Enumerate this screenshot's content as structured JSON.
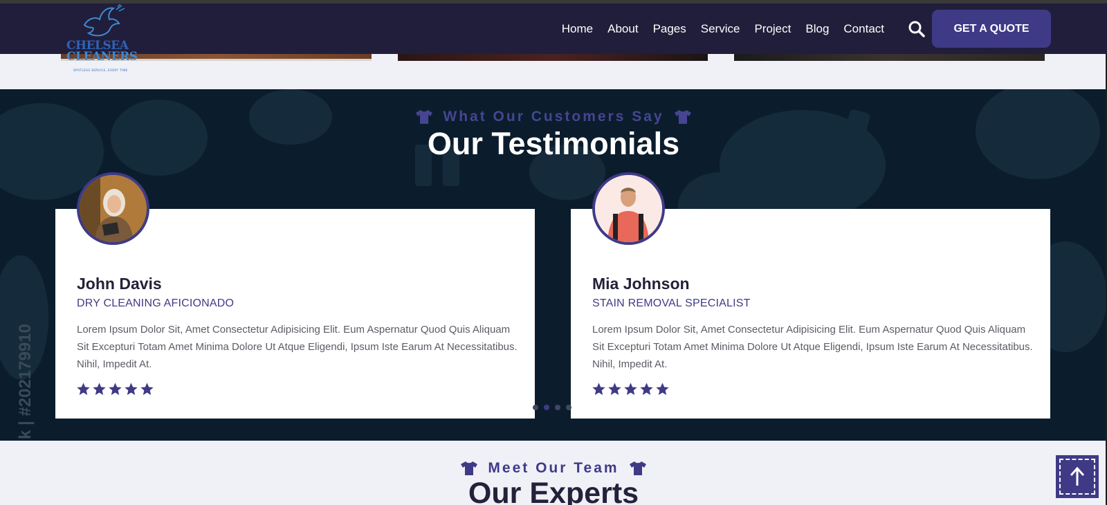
{
  "brand": {
    "name_line1": "CHELSEA",
    "name_line2": "CLEANERS",
    "tagline": "SPOTLESS SERVICE, EVERY TIME"
  },
  "nav": {
    "items": [
      "Home",
      "About",
      "Pages",
      "Service",
      "Project",
      "Blog",
      "Contact"
    ],
    "quote_label": "GET A QUOTE",
    "icons": {
      "search": "search-icon"
    }
  },
  "testimonials": {
    "subtitle": "What Our Customers Say",
    "title": "Our Testimonials",
    "items": [
      {
        "name": "John Davis",
        "role": "DRY CLEANING AFICIONADO",
        "text": "Lorem Ipsum Dolor Sit, Amet Consectetur Adipisicing Elit. Eum Aspernatur Quod Quis Aliquam Sit Excepturi Totam Amet Minima Dolore Ut Atque Eligendi, Ipsum Iste Earum At Necessitatibus. Nihil, Impedit At.",
        "rating": 5
      },
      {
        "name": "Mia Johnson",
        "role": "STAIN REMOVAL SPECIALIST",
        "text": "Lorem Ipsum Dolor Sit, Amet Consectetur Adipisicing Elit. Eum Aspernatur Quod Quis Aliquam Sit Excepturi Totam Amet Minima Dolore Ut Atque Eligendi, Ipsum Iste Earum At Necessitatibus. Nihil, Impedit At.",
        "rating": 5
      }
    ],
    "carousel_active_index": 1,
    "carousel_count": 4
  },
  "watermark": "k | #202179910",
  "team": {
    "subtitle": "Meet Our Team",
    "title": "Our Experts"
  },
  "colors": {
    "header_bg": "#211e3b",
    "accent": "#3f3a86",
    "testimonial_bg": "#0b1d2c"
  }
}
